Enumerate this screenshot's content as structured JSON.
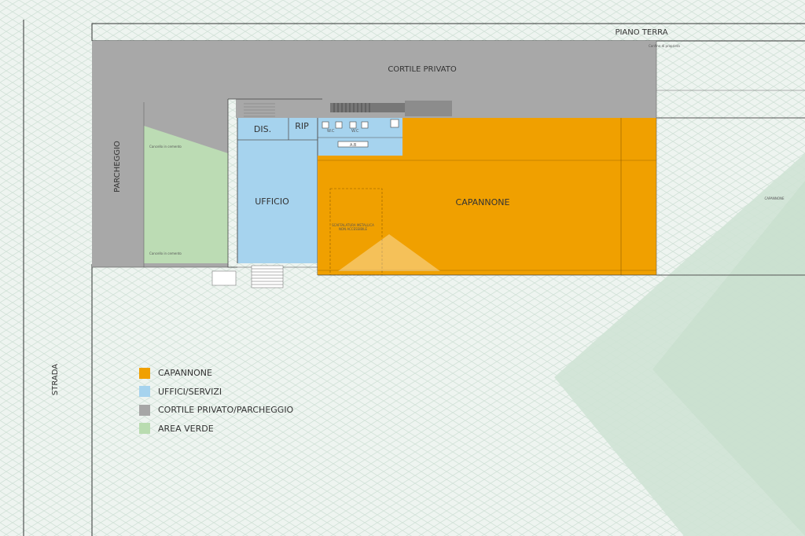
{
  "title": "PIANO TERRA",
  "rooms": {
    "cortile": "CORTILE PRIVATO",
    "parcheggio": "PARCHEGGIO",
    "dis": "DIS.",
    "rip": "RIP",
    "ufficio": "UFFICIO",
    "capannone": "CAPANNONE",
    "wc1": "W.C",
    "wc2": "W.C",
    "ab": "A.B",
    "capannone_right": "CAPANNONE"
  },
  "side_labels": {
    "strada": "STRADA"
  },
  "legend": [
    {
      "label": "CAPANNONE",
      "color": "#f0a000"
    },
    {
      "label": "UFFICI/SERVIZI",
      "color": "#a6d3ee"
    },
    {
      "label": "CORTILE PRIVATO/PARCHEGGIO",
      "color": "#a6a6a6"
    },
    {
      "label": "AREA VERDE",
      "color": "#b9dcb0"
    }
  ],
  "colors": {
    "capannone": "#f0a000",
    "uffici": "#a6d3ee",
    "cortile": "#a6a6a6",
    "verde": "#b9dcb0",
    "background_pattern": "#dde9e3",
    "background_diagonal": "#c9dfd0"
  },
  "small_notes": {
    "scaffalatura": "SCAFFALATURA METALLICA",
    "non_accessibile": "NON ACCESSIBILE",
    "cancello": "Cancello in cemento",
    "cancello2": "Cancello in cemento",
    "confine": "Confine di proprietà"
  }
}
